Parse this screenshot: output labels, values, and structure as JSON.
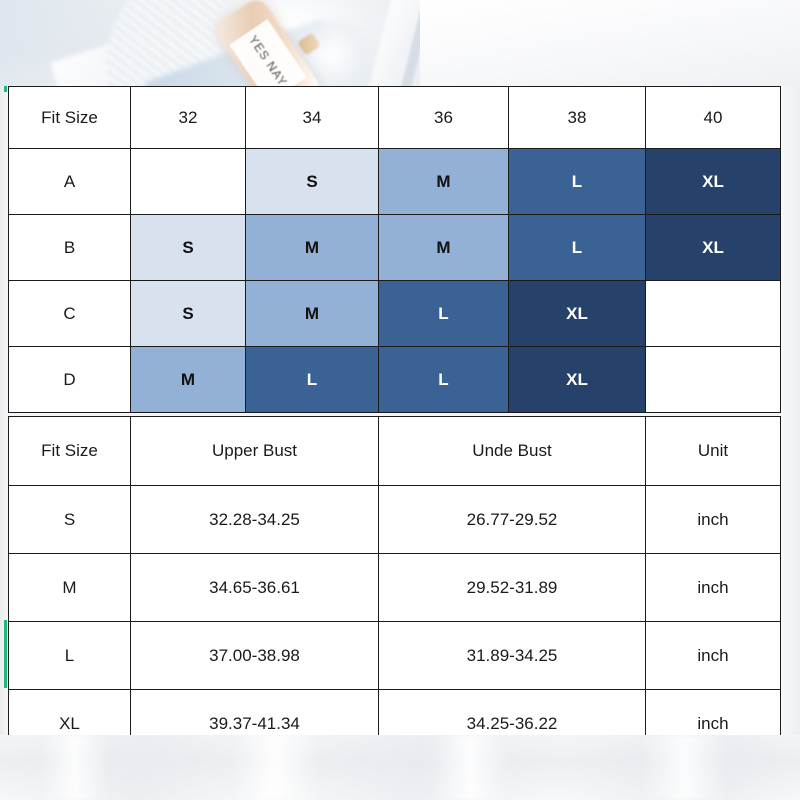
{
  "photo": {
    "bottle_label_text": "YES NAY"
  },
  "size_matrix": {
    "title_cell": "Fit Size",
    "columns": [
      "Fit Size",
      "32",
      "34",
      "36",
      "38",
      "40"
    ],
    "rows": [
      {
        "label": "A",
        "cells": [
          {
            "text": "",
            "fill": "none"
          },
          {
            "text": "S",
            "fill": "light1"
          },
          {
            "text": "M",
            "fill": "light2"
          },
          {
            "text": "L",
            "fill": "dark1"
          },
          {
            "text": "XL",
            "fill": "dark2"
          }
        ]
      },
      {
        "label": "B",
        "cells": [
          {
            "text": "S",
            "fill": "light1"
          },
          {
            "text": "M",
            "fill": "light2"
          },
          {
            "text": "M",
            "fill": "light2"
          },
          {
            "text": "L",
            "fill": "dark1"
          },
          {
            "text": "XL",
            "fill": "dark2"
          }
        ]
      },
      {
        "label": "C",
        "cells": [
          {
            "text": "S",
            "fill": "light1"
          },
          {
            "text": "M",
            "fill": "light2"
          },
          {
            "text": "L",
            "fill": "dark1"
          },
          {
            "text": "XL",
            "fill": "dark2"
          },
          {
            "text": "",
            "fill": "none"
          }
        ]
      },
      {
        "label": "D",
        "cells": [
          {
            "text": "M",
            "fill": "light2"
          },
          {
            "text": "L",
            "fill": "dark1"
          },
          {
            "text": "L",
            "fill": "dark1"
          },
          {
            "text": "XL",
            "fill": "dark2"
          },
          {
            "text": "",
            "fill": "none"
          }
        ]
      }
    ]
  },
  "measure_table": {
    "columns": [
      "Fit Size",
      "Upper Bust",
      "Unde Bust",
      "Unit"
    ],
    "rows": [
      {
        "size": "S",
        "upper_bust": "32.28-34.25",
        "under_bust": "26.77-29.52",
        "unit": "inch"
      },
      {
        "size": "M",
        "upper_bust": "34.65-36.61",
        "under_bust": "29.52-31.89",
        "unit": "inch"
      },
      {
        "size": "L",
        "upper_bust": "37.00-38.98",
        "under_bust": "31.89-34.25",
        "unit": "inch"
      },
      {
        "size": "XL",
        "upper_bust": "39.37-41.34",
        "under_bust": "34.25-36.22",
        "unit": "inch"
      }
    ]
  },
  "colors": {
    "light1": "#d8e2ee",
    "light2": "#93b0d6",
    "dark1": "#3a6294",
    "dark2": "#27426a",
    "grid": "#1b1b1b",
    "text_dark": "#111111",
    "text_light": "#ffffff",
    "accent_green": "#1fb87a"
  }
}
